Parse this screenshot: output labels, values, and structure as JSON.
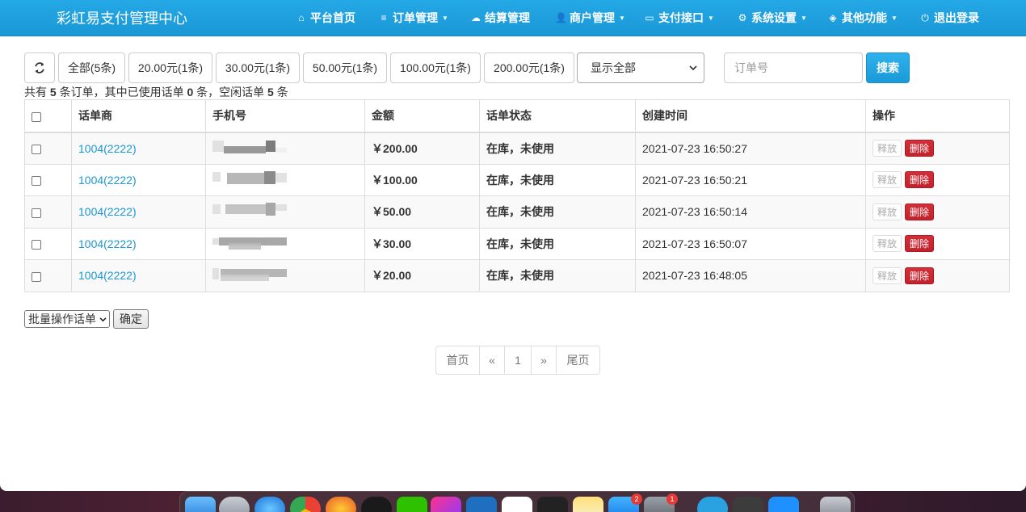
{
  "navbar": {
    "brand": "彩虹易支付管理中心",
    "items": [
      {
        "label": "平台首页",
        "icon": "home-icon",
        "dropdown": false
      },
      {
        "label": "订单管理",
        "icon": "list-icon",
        "dropdown": true
      },
      {
        "label": "结算管理",
        "icon": "cloud-icon",
        "dropdown": false
      },
      {
        "label": "商户管理",
        "icon": "user-icon",
        "dropdown": true
      },
      {
        "label": "支付接口",
        "icon": "credit-card-icon",
        "dropdown": true
      },
      {
        "label": "系统设置",
        "icon": "gear-icon",
        "dropdown": true
      },
      {
        "label": "其他功能",
        "icon": "cube-icon",
        "dropdown": true
      },
      {
        "label": "退出登录",
        "icon": "power-icon",
        "dropdown": false
      }
    ]
  },
  "toolbar": {
    "filters": [
      "全部(5条)",
      "20.00元(1条)",
      "30.00元(1条)",
      "50.00元(1条)",
      "100.00元(1条)",
      "200.00元(1条)"
    ],
    "status_select": "显示全部",
    "order_placeholder": "订单号",
    "search_label": "搜索"
  },
  "summary": {
    "prefix": "共有",
    "total": "5",
    "mid1": "条订单，其中已使用话单",
    "used": "0",
    "mid2": "条，空闲话单",
    "idle": "5",
    "suffix": "条"
  },
  "table": {
    "headers": [
      "话单商",
      "手机号",
      "金额",
      "话单状态",
      "创建时间",
      "操作"
    ],
    "rows": [
      {
        "merchant": "1004(2222)",
        "amount": "￥200.00",
        "status": "在库，未使用",
        "created": "2021-07-23 16:50:27"
      },
      {
        "merchant": "1004(2222)",
        "amount": "￥100.00",
        "status": "在库，未使用",
        "created": "2021-07-23 16:50:21"
      },
      {
        "merchant": "1004(2222)",
        "amount": "￥50.00",
        "status": "在库，未使用",
        "created": "2021-07-23 16:50:14"
      },
      {
        "merchant": "1004(2222)",
        "amount": "￥30.00",
        "status": "在库，未使用",
        "created": "2021-07-23 16:50:07"
      },
      {
        "merchant": "1004(2222)",
        "amount": "￥20.00",
        "status": "在库，未使用",
        "created": "2021-07-23 16:48:05"
      }
    ],
    "release_label": "释放",
    "delete_label": "删除"
  },
  "batch": {
    "select_label": "批量操作话单",
    "confirm_label": "确定"
  },
  "pagination": {
    "first": "首页",
    "prev": "«",
    "page": "1",
    "next": "»",
    "last": "尾页"
  },
  "dock": {
    "badges": [
      "2",
      "1"
    ]
  },
  "colors": {
    "navbar": "#1b98d6",
    "link": "#1b98d6",
    "delete": "#c9252f"
  }
}
